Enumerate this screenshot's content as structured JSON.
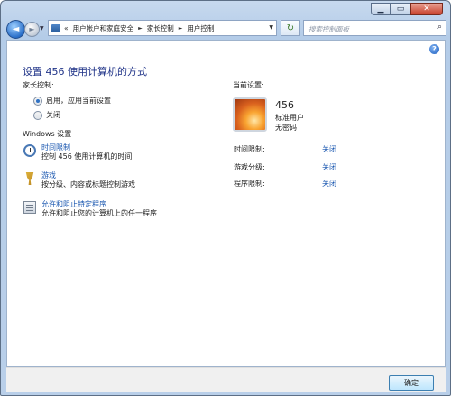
{
  "window": {
    "controls": {
      "minimize": "▁",
      "maximize": "▭",
      "close": "✕"
    }
  },
  "nav": {
    "back_glyph": "◄",
    "forward_glyph": "►",
    "overflow": "«",
    "breadcrumbs": [
      "用户帐户和家庭安全",
      "家长控制",
      "用户控制"
    ],
    "search_placeholder": "搜索控制面板"
  },
  "page": {
    "title": "设置 456 使用计算机的方式",
    "parental_controls_label": "家长控制:",
    "options": [
      {
        "label": "启用，应用当前设置",
        "selected": true
      },
      {
        "label": "关闭",
        "selected": false
      }
    ],
    "windows_settings_label": "Windows 设置",
    "settings": [
      {
        "icon": "clock-icon",
        "link": "时间限制",
        "desc": "控制 456 使用计算机的时间"
      },
      {
        "icon": "game-trophy-icon",
        "link": "游戏",
        "desc": "按分级、内容或标题控制游戏"
      },
      {
        "icon": "program-list-icon",
        "link": "允许和阻止特定程序",
        "desc": "允许和阻止您的计算机上的任一程序"
      }
    ]
  },
  "current": {
    "label": "当前设置:",
    "user_name": "456",
    "account_type": "标准用户",
    "password_status": "无密码",
    "rows": [
      {
        "label": "时间限制:",
        "value": "关闭"
      },
      {
        "label": "游戏分级:",
        "value": "关闭"
      },
      {
        "label": "程序限制:",
        "value": "关闭"
      }
    ]
  },
  "footer": {
    "ok_label": "确定"
  },
  "colors": {
    "link": "#1a57b0",
    "title": "#1e3287",
    "chrome": "#b9cfe9"
  }
}
